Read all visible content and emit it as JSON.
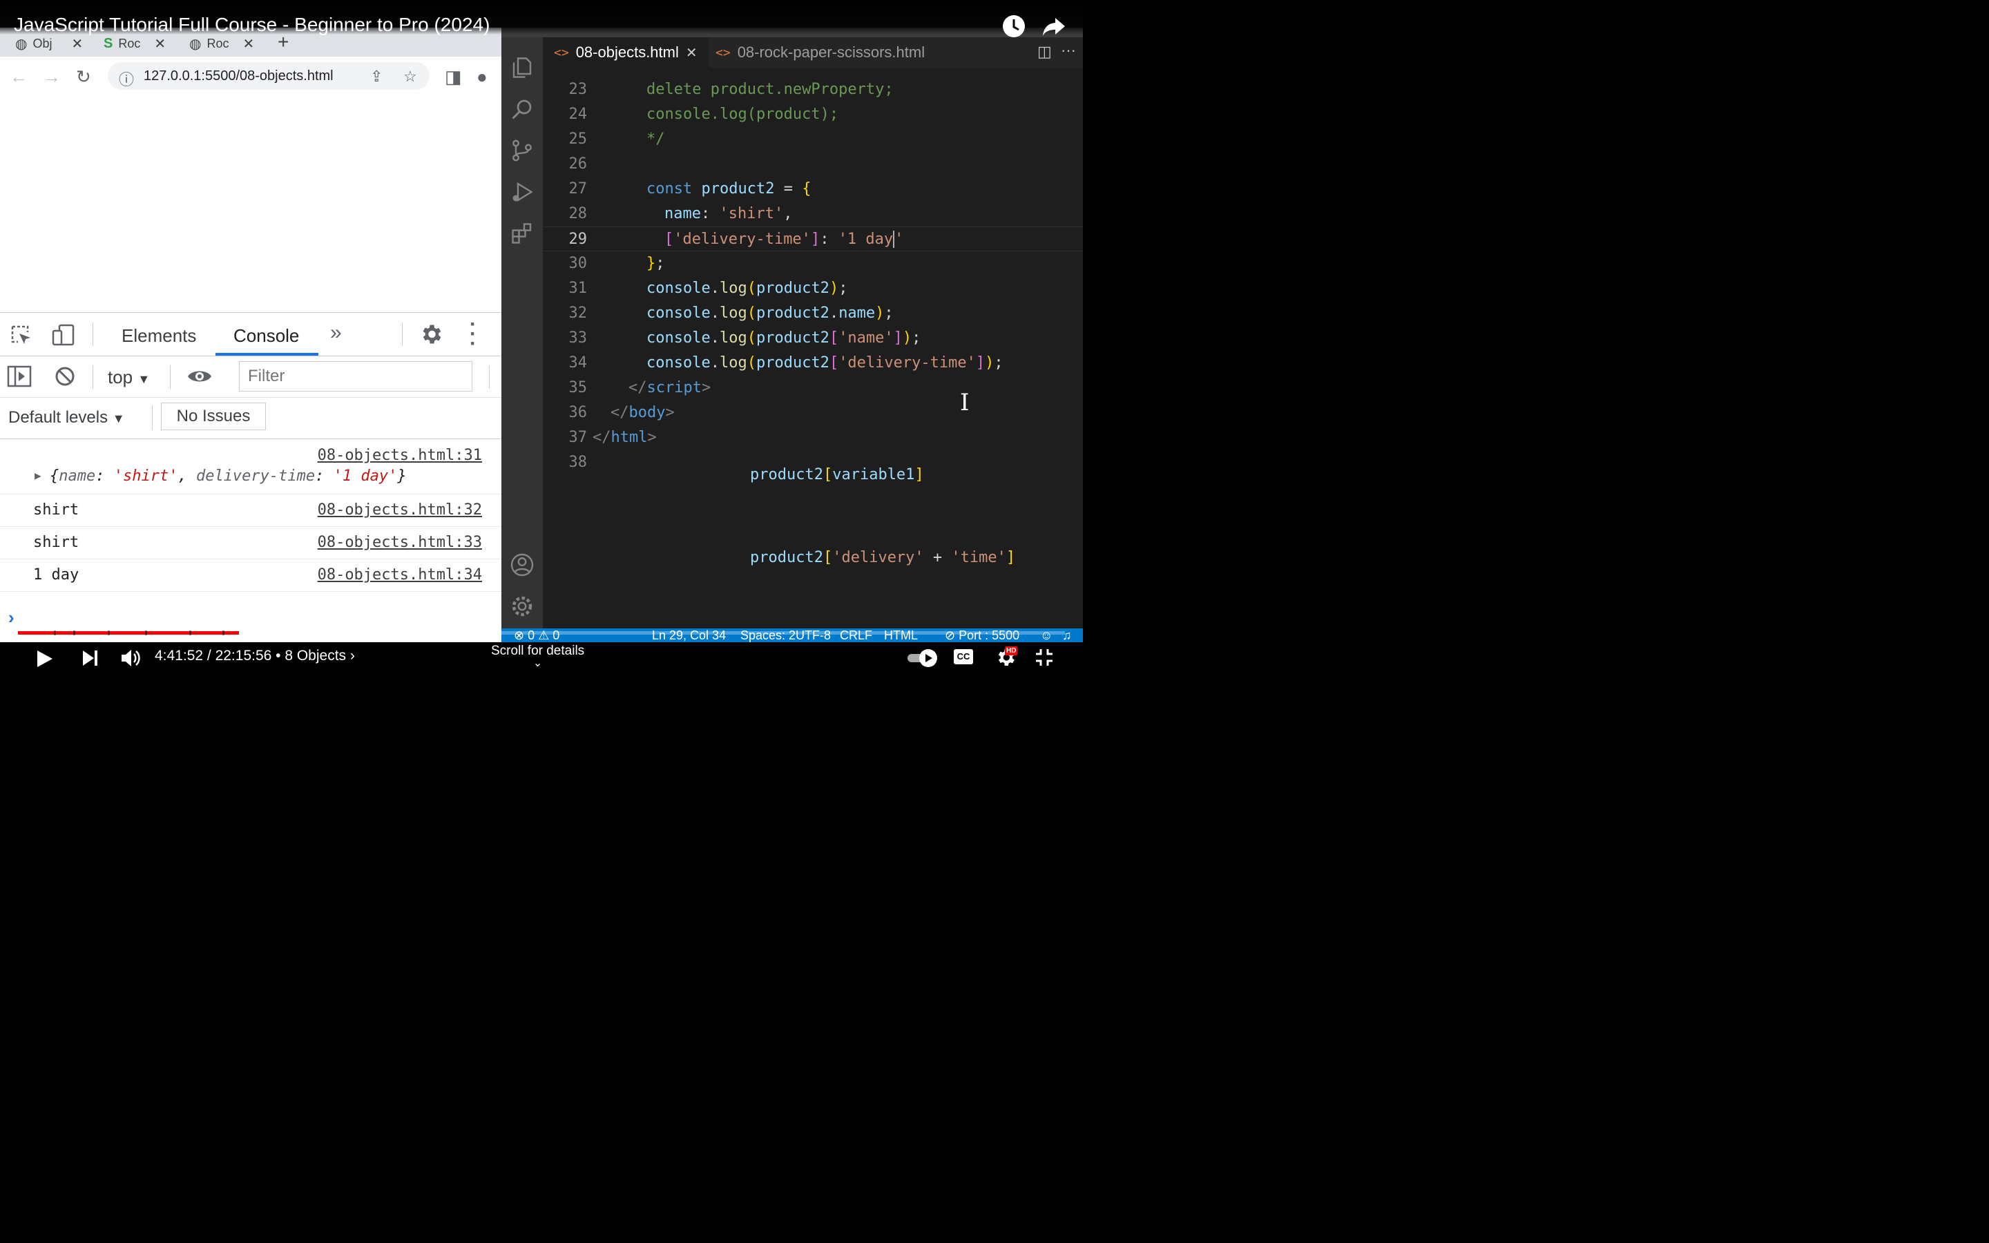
{
  "video": {
    "title": "JavaScript Tutorial Full Course - Beginner to Pro (2024)",
    "time": "4:41:52 / 22:15:56 • 8 Objects ›",
    "scroll_hint": "Scroll for details",
    "progress_fraction": 0.211,
    "accent_color": "#ff0000",
    "icons": [
      "watch-later-icon",
      "share-icon",
      "play-icon",
      "next-icon",
      "volume-icon",
      "autoplay-toggle-icon",
      "captions-icon",
      "settings-hd-icon",
      "exit-fullscreen-icon"
    ],
    "hd_badge": "HD",
    "cc_label": "CC"
  },
  "browser": {
    "tabs": [
      "Obj",
      "Roc",
      "Roc"
    ],
    "new_tab": "+",
    "url": "127.0.0.1:5500/08-objects.html",
    "devtools": {
      "tabs": [
        "Elements",
        "Console"
      ],
      "more": "»",
      "context": "top",
      "filter_placeholder": "Filter",
      "levels": "Default levels",
      "issues": "No Issues",
      "messages": [
        {
          "source": "08-objects.html:31",
          "object": true
        },
        {
          "text": "shirt",
          "source": "08-objects.html:32"
        },
        {
          "text": "shirt",
          "source": "08-objects.html:33"
        },
        {
          "text": "1 day",
          "source": "08-objects.html:34"
        }
      ],
      "object_preview": {
        "open": "{",
        "k1": "name",
        "v1": "'shirt'",
        "k2": "delivery-time",
        "v2": "'1 day'",
        "close": "}"
      },
      "prompt": "›"
    }
  },
  "vscode": {
    "tabs": [
      {
        "label": "08-objects.html",
        "active": true
      },
      {
        "label": "08-rock-paper-scissors.html",
        "active": false
      }
    ],
    "line_numbers": [
      "23",
      "24",
      "25",
      "26",
      "27",
      "28",
      "29",
      "30",
      "31",
      "32",
      "33",
      "34",
      "35",
      "36",
      "37",
      "38"
    ],
    "current_line": "29",
    "annotations": [
      "product2[variable1]",
      "product2['delivery' + 'time']"
    ],
    "status": {
      "problems": "⊗ 0 ⚠ 0",
      "position": "Ln 29, Col 34",
      "spaces": "Spaces: 2",
      "encoding": "UTF-8",
      "eol": "CRLF",
      "language": "HTML",
      "port": "⊘ Port : 5500"
    },
    "statusbar_color": "#007acc"
  }
}
